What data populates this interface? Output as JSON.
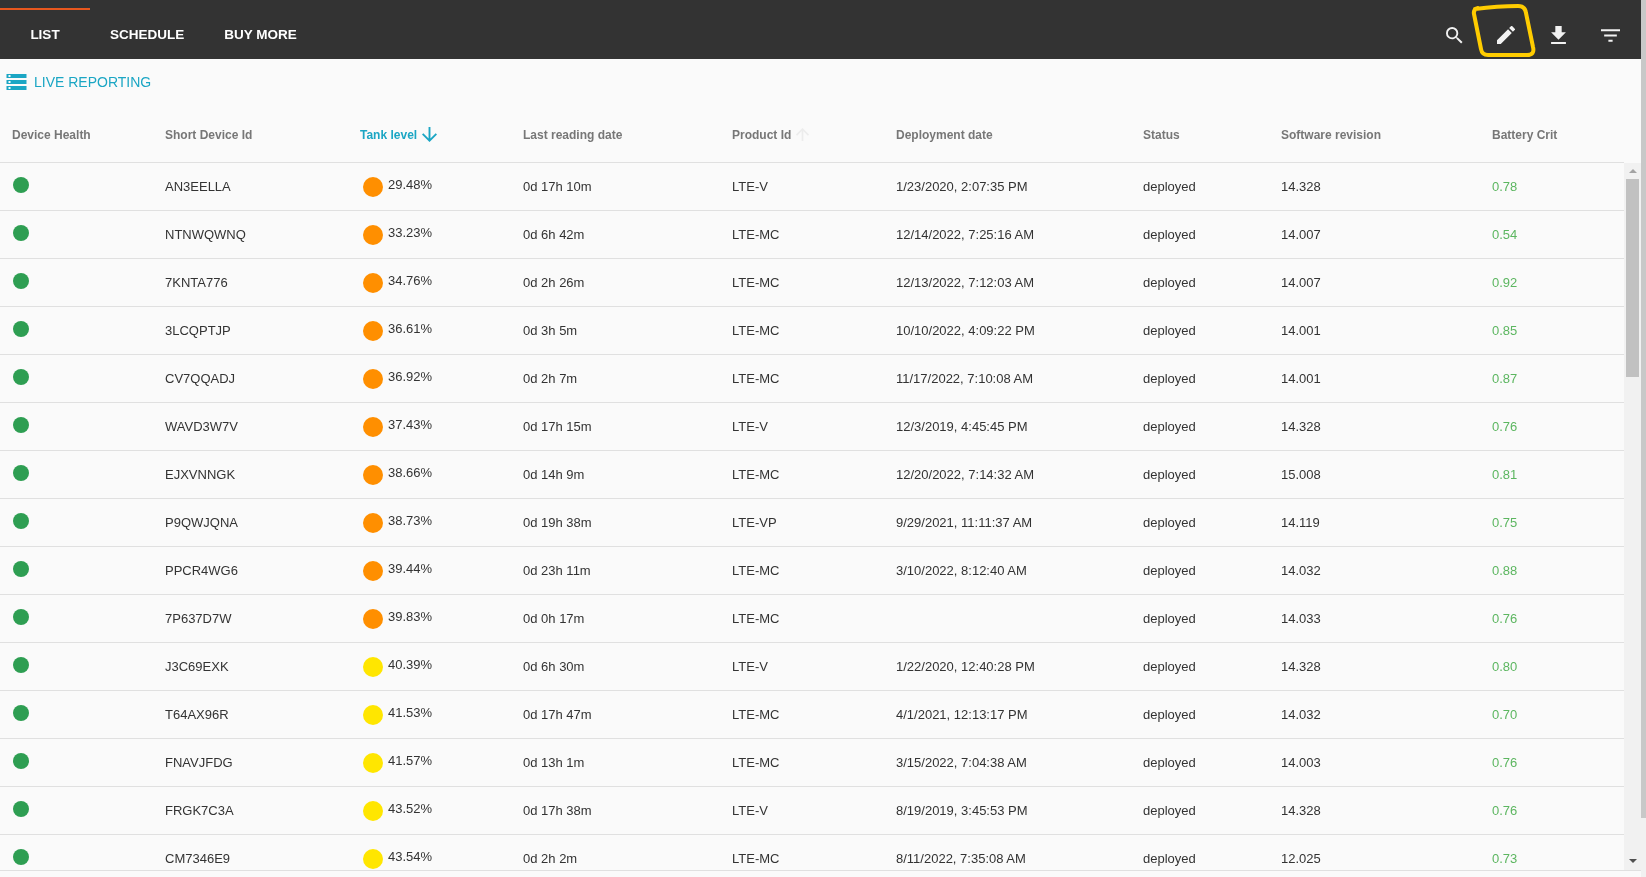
{
  "tabs": [
    {
      "label": "LIST",
      "selected": true
    },
    {
      "label": "SCHEDULE",
      "selected": false
    },
    {
      "label": "BUY MORE",
      "selected": false
    }
  ],
  "section_title": "LIVE REPORTING",
  "table": {
    "columns": [
      {
        "label": "Device Health",
        "selected": false,
        "kind": "plain"
      },
      {
        "label": "Short Device Id",
        "selected": false,
        "kind": "plain"
      },
      {
        "label": "Tank level",
        "selected": true,
        "kind": "descending"
      },
      {
        "label": "Last reading date",
        "selected": false,
        "kind": "plain"
      },
      {
        "label": "Product Id",
        "selected": false,
        "kind": "ascending"
      },
      {
        "label": "Deployment date",
        "selected": false,
        "kind": "plain"
      },
      {
        "label": "Status",
        "selected": false,
        "kind": "plain"
      },
      {
        "label": "Software revision",
        "selected": false,
        "kind": "plain"
      },
      {
        "label": "Battery Crit",
        "selected": false,
        "kind": "plain"
      }
    ],
    "rows": [
      {
        "health": {
          "color": "#2e9e52"
        },
        "short_device_id": "AN3EELLA",
        "tank_level": {
          "value": "29.48%",
          "color": "#ff8f00"
        },
        "last_reading_date": "0d 17h 10m",
        "product_id": "LTE-V",
        "deployment_date": "1/23/2020, 2:07:35 PM",
        "status": "deployed",
        "software_revision": "14.328",
        "battery_crit": "0.78"
      },
      {
        "health": {
          "color": "#2e9e52"
        },
        "short_device_id": "NTNWQWNQ",
        "tank_level": {
          "value": "33.23%",
          "color": "#ff8f00"
        },
        "last_reading_date": "0d 6h 42m",
        "product_id": "LTE-MC",
        "deployment_date": "12/14/2022, 7:25:16 AM",
        "status": "deployed",
        "software_revision": "14.007",
        "battery_crit": "0.54"
      },
      {
        "health": {
          "color": "#2e9e52"
        },
        "short_device_id": "7KNTA776",
        "tank_level": {
          "value": "34.76%",
          "color": "#ff8f00"
        },
        "last_reading_date": "0d 2h 26m",
        "product_id": "LTE-MC",
        "deployment_date": "12/13/2022, 7:12:03 AM",
        "status": "deployed",
        "software_revision": "14.007",
        "battery_crit": "0.92"
      },
      {
        "health": {
          "color": "#2e9e52"
        },
        "short_device_id": "3LCQPTJP",
        "tank_level": {
          "value": "36.61%",
          "color": "#ff8f00"
        },
        "last_reading_date": "0d 3h 5m",
        "product_id": "LTE-MC",
        "deployment_date": "10/10/2022, 4:09:22 PM",
        "status": "deployed",
        "software_revision": "14.001",
        "battery_crit": "0.85"
      },
      {
        "health": {
          "color": "#2e9e52"
        },
        "short_device_id": "CV7QQADJ",
        "tank_level": {
          "value": "36.92%",
          "color": "#ff8f00"
        },
        "last_reading_date": "0d 2h 7m",
        "product_id": "LTE-MC",
        "deployment_date": "11/17/2022, 7:10:08 AM",
        "status": "deployed",
        "software_revision": "14.001",
        "battery_crit": "0.87"
      },
      {
        "health": {
          "color": "#2e9e52"
        },
        "short_device_id": "WAVD3W7V",
        "tank_level": {
          "value": "37.43%",
          "color": "#ff8f00"
        },
        "last_reading_date": "0d 17h 15m",
        "product_id": "LTE-V",
        "deployment_date": "12/3/2019, 4:45:45 PM",
        "status": "deployed",
        "software_revision": "14.328",
        "battery_crit": "0.76"
      },
      {
        "health": {
          "color": "#2e9e52"
        },
        "short_device_id": "EJXVNNGK",
        "tank_level": {
          "value": "38.66%",
          "color": "#ff8f00"
        },
        "last_reading_date": "0d 14h 9m",
        "product_id": "LTE-MC",
        "deployment_date": "12/20/2022, 7:14:32 AM",
        "status": "deployed",
        "software_revision": "15.008",
        "battery_crit": "0.81"
      },
      {
        "health": {
          "color": "#2e9e52"
        },
        "short_device_id": "P9QWJQNA",
        "tank_level": {
          "value": "38.73%",
          "color": "#ff8f00"
        },
        "last_reading_date": "0d 19h 38m",
        "product_id": "LTE-VP",
        "deployment_date": "9/29/2021, 11:11:37 AM",
        "status": "deployed",
        "software_revision": "14.119",
        "battery_crit": "0.75"
      },
      {
        "health": {
          "color": "#2e9e52"
        },
        "short_device_id": "PPCR4WG6",
        "tank_level": {
          "value": "39.44%",
          "color": "#ff8f00"
        },
        "last_reading_date": "0d 23h 11m",
        "product_id": "LTE-MC",
        "deployment_date": "3/10/2022, 8:12:40 AM",
        "status": "deployed",
        "software_revision": "14.032",
        "battery_crit": "0.88"
      },
      {
        "health": {
          "color": "#2e9e52"
        },
        "short_device_id": "7P637D7W",
        "tank_level": {
          "value": "39.83%",
          "color": "#ff8f00"
        },
        "last_reading_date": "0d 0h 17m",
        "product_id": "LTE-MC",
        "status": "deployed",
        "software_revision": "14.033",
        "battery_crit": "0.76"
      },
      {
        "health": {
          "color": "#2e9e52"
        },
        "short_device_id": "J3C69EXK",
        "tank_level": {
          "value": "40.39%",
          "color": "#ffe600"
        },
        "last_reading_date": "0d 6h 30m",
        "product_id": "LTE-V",
        "deployment_date": "1/22/2020, 12:40:28 PM",
        "status": "deployed",
        "software_revision": "14.328",
        "battery_crit": "0.80"
      },
      {
        "health": {
          "color": "#2e9e52"
        },
        "short_device_id": "T64AX96R",
        "tank_level": {
          "value": "41.53%",
          "color": "#ffe600"
        },
        "last_reading_date": "0d 17h 47m",
        "product_id": "LTE-MC",
        "deployment_date": "4/1/2021, 12:13:17 PM",
        "status": "deployed",
        "software_revision": "14.032",
        "battery_crit": "0.70"
      },
      {
        "health": {
          "color": "#2e9e52"
        },
        "short_device_id": "FNAVJFDG",
        "tank_level": {
          "value": "41.57%",
          "color": "#ffe600"
        },
        "last_reading_date": "0d 13h 1m",
        "product_id": "LTE-MC",
        "deployment_date": "3/15/2022, 7:04:38 AM",
        "status": "deployed",
        "software_revision": "14.003",
        "battery_crit": "0.76"
      },
      {
        "health": {
          "color": "#2e9e52"
        },
        "short_device_id": "FRGK7C3A",
        "tank_level": {
          "value": "43.52%",
          "color": "#ffe600"
        },
        "last_reading_date": "0d 17h 38m",
        "product_id": "LTE-V",
        "deployment_date": "8/19/2019, 3:45:53 PM",
        "status": "deployed",
        "software_revision": "14.328",
        "battery_crit": "0.76"
      },
      {
        "health": {
          "color": "#2e9e52"
        },
        "short_device_id": "CM7346E9",
        "tank_level": {
          "value": "43.54%",
          "color": "#ffe600"
        },
        "last_reading_date": "0d 2h 2m",
        "product_id": "LTE-MC",
        "deployment_date": "8/11/2022, 7:35:08 AM",
        "status": "deployed",
        "software_revision": "12.025",
        "battery_crit": "0.73"
      }
    ]
  }
}
